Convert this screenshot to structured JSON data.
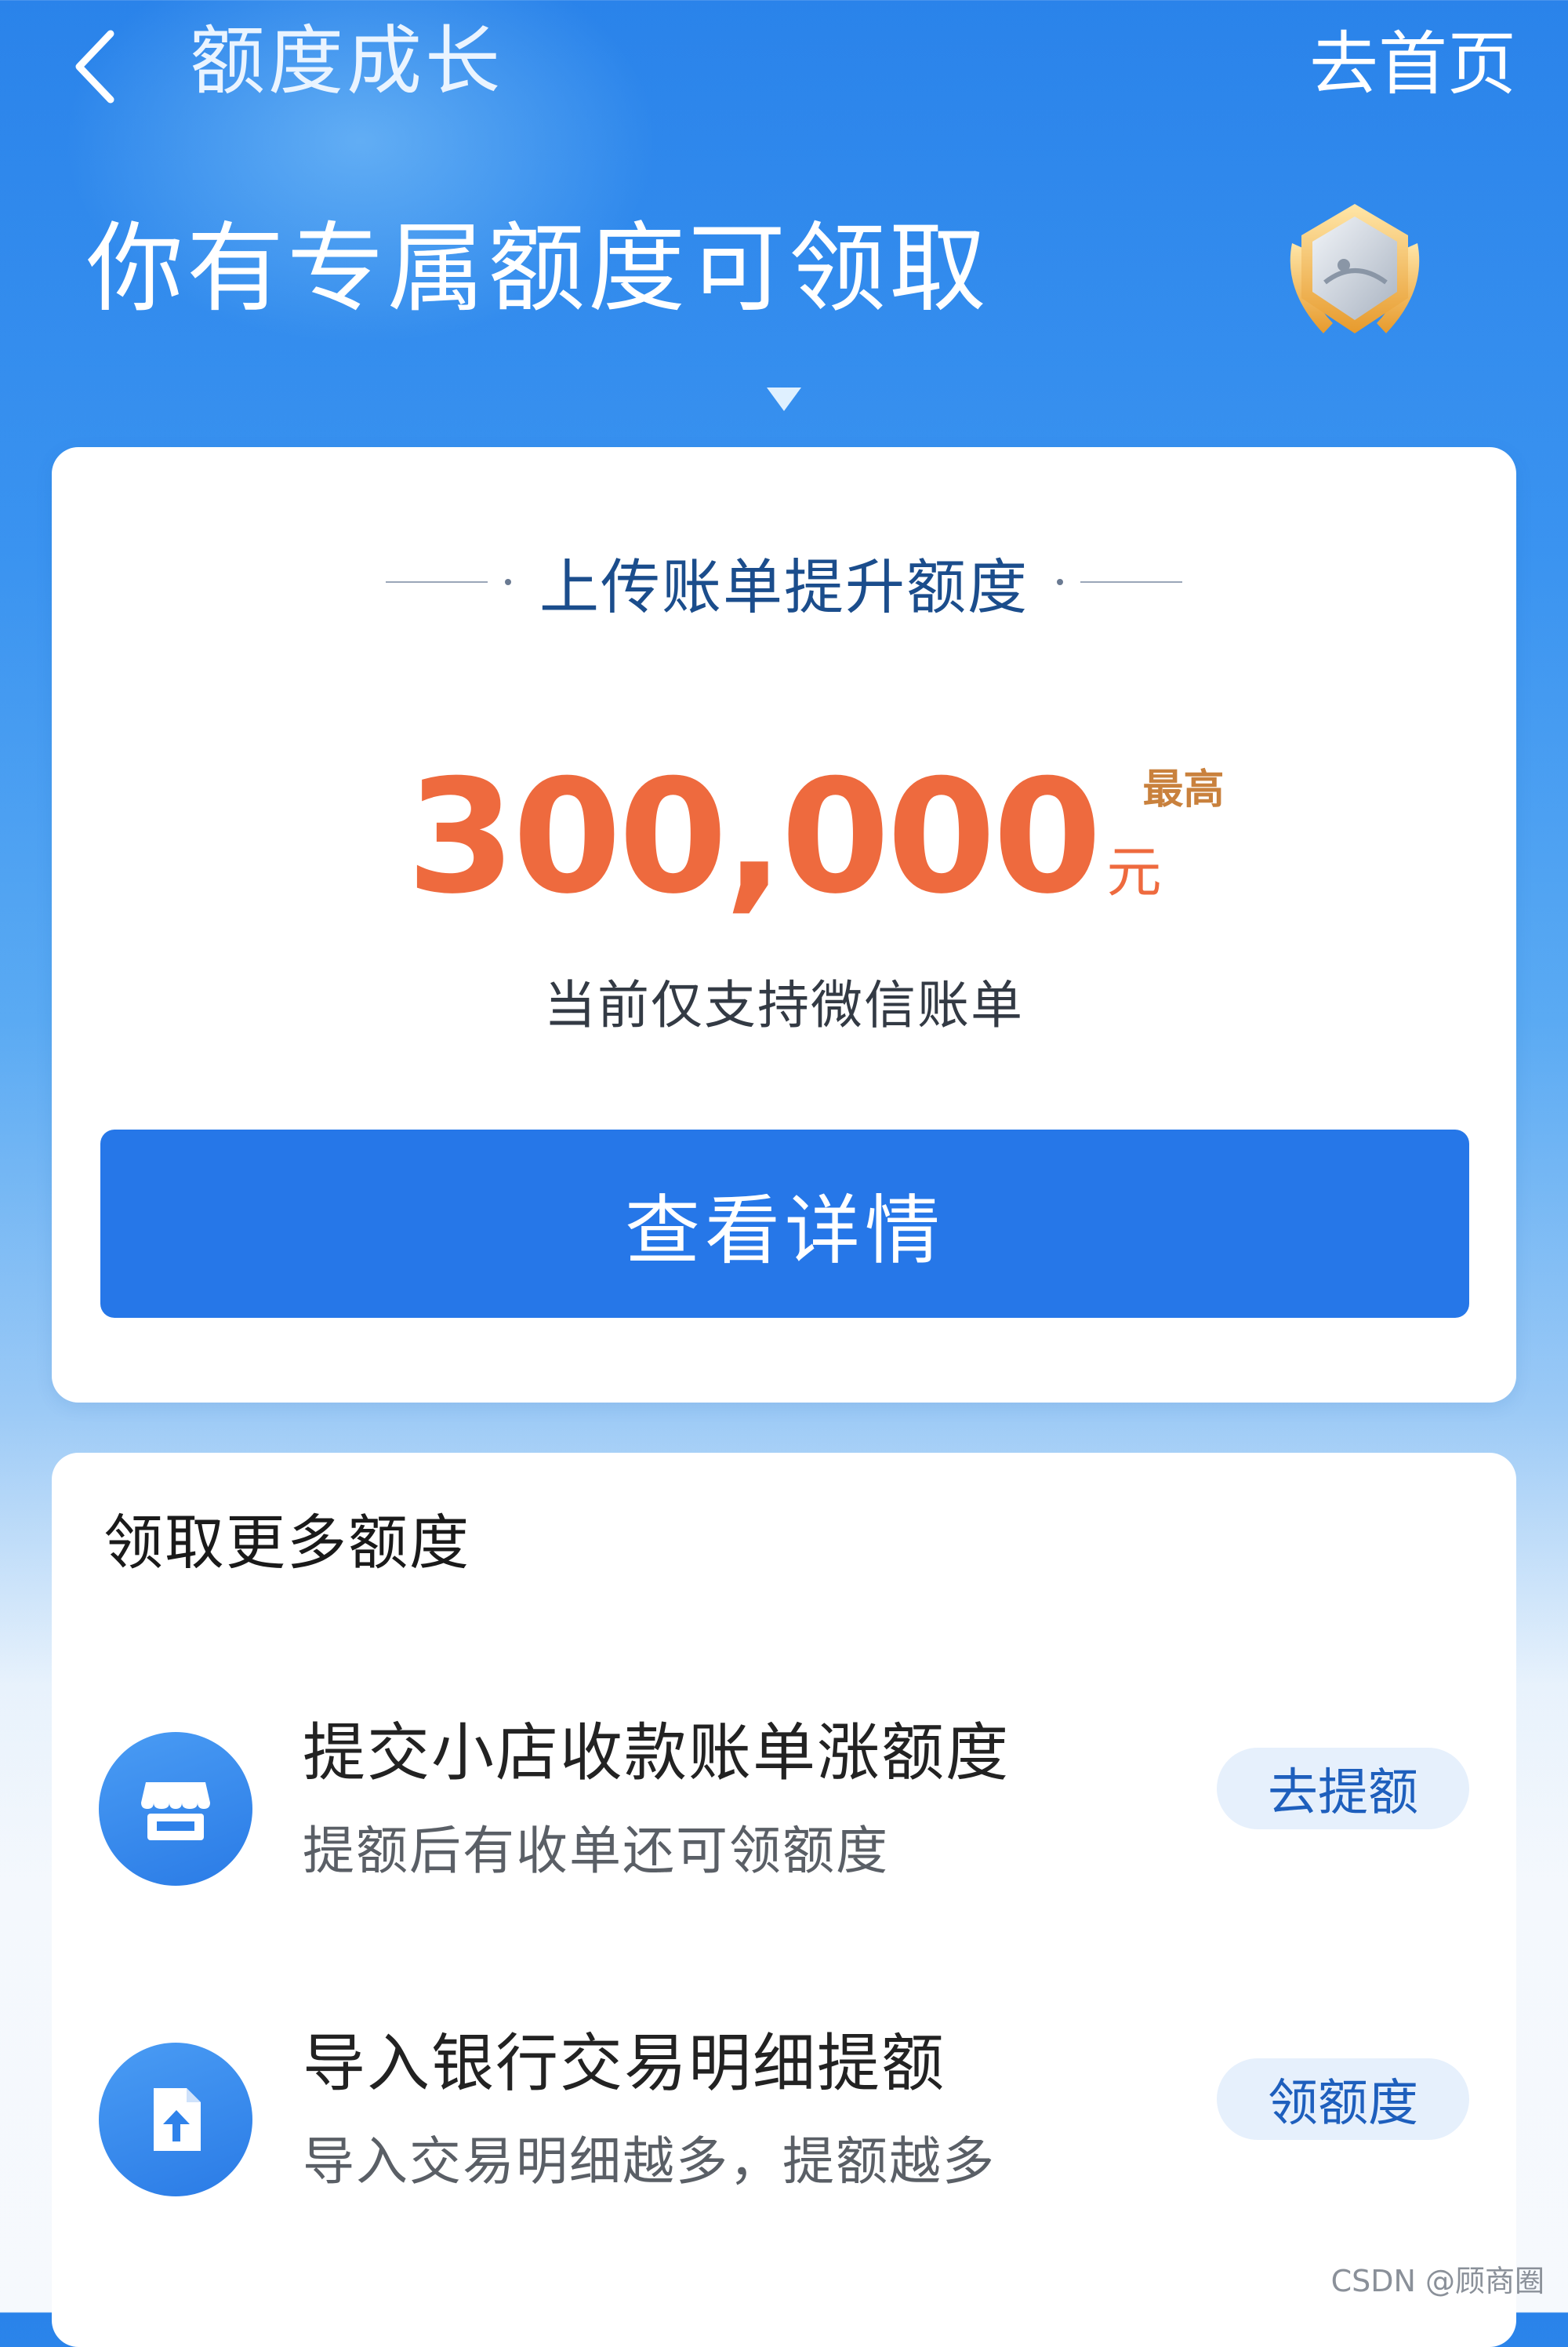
{
  "nav": {
    "title": "额度成长",
    "home_link": "去首页"
  },
  "hero": {
    "headline": "你有专属额度可领取"
  },
  "main_card": {
    "section_title": "上传账单提升额度",
    "max_tag": "最高",
    "amount": "300,000",
    "currency": "元",
    "note": "当前仅支持微信账单",
    "button_label": "查看详情"
  },
  "more_card": {
    "title": "领取更多额度",
    "items": [
      {
        "icon": "store-icon",
        "title": "提交小店收款账单涨额度",
        "desc": "提额后有收单还可领额度",
        "button": "去提额"
      },
      {
        "icon": "upload-document-icon",
        "title": "导入银行交易明细提额",
        "desc": "导入交易明细越多，提额越多",
        "button": "领额度"
      }
    ]
  },
  "watermark": "CSDN @顾商圈",
  "colors": {
    "primary_blue": "#2677e8",
    "amount_orange": "#ee6a3e",
    "section_title_blue": "#1b4d8c"
  }
}
